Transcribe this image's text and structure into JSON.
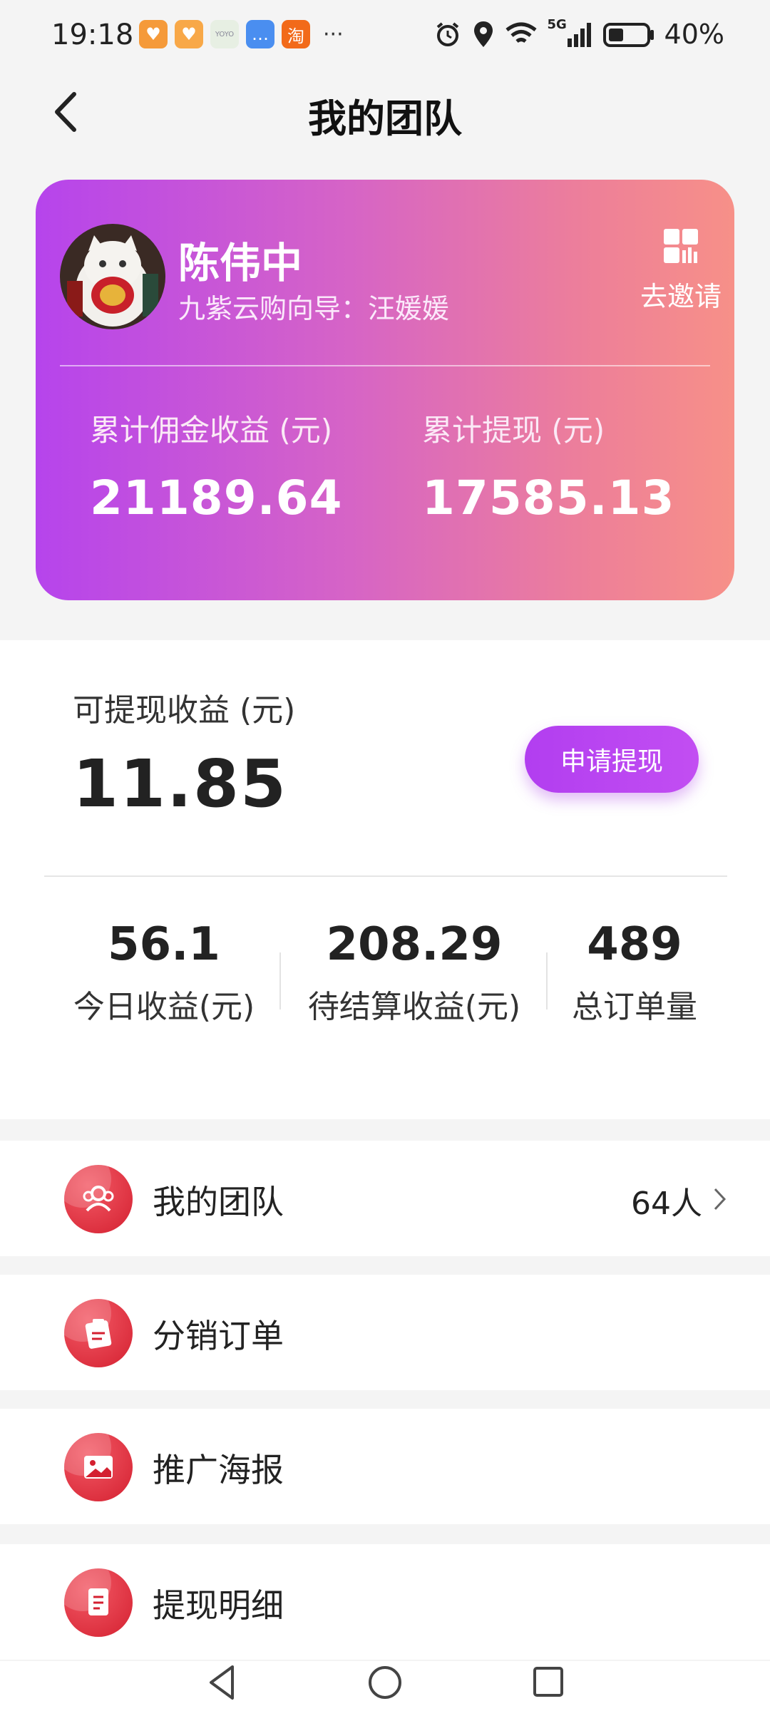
{
  "status_bar": {
    "time": "19:18",
    "app_icons": [
      {
        "name": "heart-app-icon",
        "color": "#f59a3a",
        "glyph": "♥"
      },
      {
        "name": "heart-app-icon-2",
        "color": "#f8a848",
        "glyph": "♥"
      },
      {
        "name": "yoyo-app-icon",
        "color": "#e7efe3",
        "glyph": "YOYO"
      },
      {
        "name": "message-app-icon",
        "color": "#4a8ef0",
        "glyph": "…"
      },
      {
        "name": "taobao-app-icon",
        "color": "#f26a1a",
        "glyph": "淘"
      }
    ],
    "more": "···",
    "network": "5G",
    "battery_percent": "40%",
    "battery_level": 0.4
  },
  "header": {
    "title": "我的团队"
  },
  "profile": {
    "name": "陈伟中",
    "subtitle": "九紫云购向导：汪媛媛",
    "invite_label": "去邀请",
    "stats": [
      {
        "label": "累计佣金收益 (元)",
        "value": "21189.64"
      },
      {
        "label": "累计提现 (元)",
        "value": "17585.13"
      }
    ]
  },
  "withdraw": {
    "label": "可提现收益 (元)",
    "amount": "11.85",
    "button_label": "申请提现",
    "accent": "#b23ef0"
  },
  "summary": [
    {
      "value": "56.1",
      "label": "今日收益(元)"
    },
    {
      "value": "208.29",
      "label": "待结算收益(元)"
    },
    {
      "value": "489",
      "label": "总订单量"
    }
  ],
  "menu": [
    {
      "label": "我的团队",
      "count": "64人",
      "icon": "team-icon"
    },
    {
      "label": "分销订单",
      "count": "",
      "icon": "order-icon"
    },
    {
      "label": "推广海报",
      "count": "",
      "icon": "poster-icon"
    },
    {
      "label": "提现明细",
      "count": "",
      "icon": "withdraw-detail-icon"
    }
  ],
  "colors": {
    "card_gradient_start": "#b644ec",
    "card_gradient_end": "#f79088",
    "menu_icon_red": "#d42030"
  }
}
